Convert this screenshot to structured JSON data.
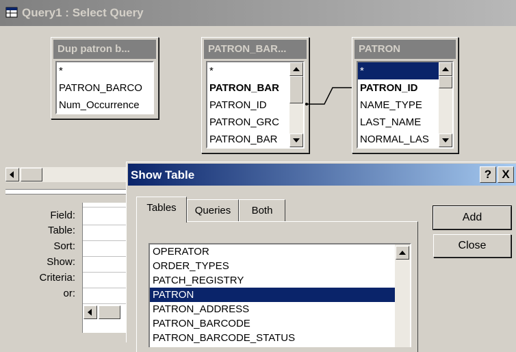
{
  "window": {
    "title": "Query1 : Select Query"
  },
  "field_lists": [
    {
      "title": "Dup patron b...",
      "fields": [
        "*",
        "PATRON_BARCO",
        "Num_Occurrence"
      ]
    },
    {
      "title": "PATRON_BAR...",
      "fields": [
        "*",
        "PATRON_BAR",
        "PATRON_ID",
        "PATRON_GRC",
        "PATRON_BAR"
      ],
      "bold_index": 1
    },
    {
      "title": "PATRON",
      "fields": [
        "*",
        "PATRON_ID",
        "NAME_TYPE",
        "LAST_NAME",
        "NORMAL_LAS"
      ],
      "bold_index": 1,
      "selected_index": 0
    }
  ],
  "grid": {
    "row_labels": [
      "Field:",
      "Table:",
      "Sort:",
      "Show:",
      "Criteria:",
      "or:"
    ]
  },
  "dialog": {
    "title": "Show Table",
    "help_label": "?",
    "close_label": "X",
    "tabs": [
      "Tables",
      "Queries",
      "Both"
    ],
    "active_tab": "Tables",
    "tables": [
      "OPERATOR",
      "ORDER_TYPES",
      "PATCH_REGISTRY",
      "PATRON",
      "PATRON_ADDRESS",
      "PATRON_BARCODE",
      "PATRON_BARCODE_STATUS"
    ],
    "selected_table": "PATRON",
    "add_label": "Add",
    "close_button_label": "Close"
  },
  "icons": {
    "app": "query-icon",
    "scroll_up": "arrow-up-icon",
    "scroll_down": "arrow-down-icon",
    "scroll_left": "arrow-left-icon"
  },
  "colors": {
    "selection": "#0a246a",
    "active_title_start": "#0a246a",
    "active_title_end": "#a6caf0",
    "inactive_title": "#808080"
  }
}
